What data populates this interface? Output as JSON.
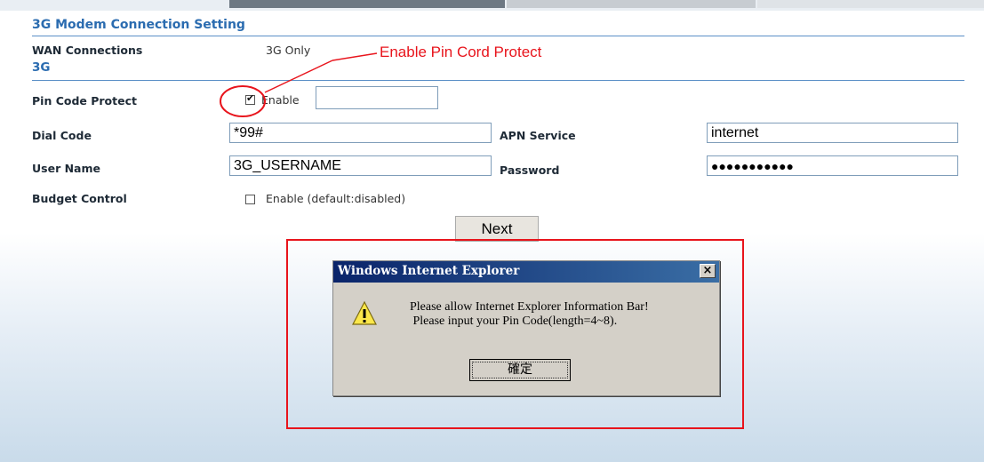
{
  "section": {
    "title": "3G Modem Connection Setting",
    "subtitle": "3G"
  },
  "wan": {
    "label": "WAN Connections",
    "value": "3G Only"
  },
  "pin": {
    "label": "Pin Code Protect",
    "enable_label": "Enable",
    "checked": true,
    "value": ""
  },
  "dial": {
    "label": "Dial Code",
    "value": "*99#"
  },
  "apn": {
    "label": "APN Service",
    "value": "internet"
  },
  "user": {
    "label": "User Name",
    "value": "3G_USERNAME"
  },
  "password": {
    "label": "Password",
    "value": "●●●●●●●●●●●"
  },
  "budget": {
    "label": "Budget Control",
    "enable_label": "Enable (default:disabled)",
    "checked": false
  },
  "next_button": "Next",
  "annotation": {
    "text": "Enable Pin Cord Protect",
    "color": "#e8141c"
  },
  "dialog": {
    "title": "Windows Internet Explorer",
    "close": "×",
    "line1": "Please allow Internet Explorer Information Bar!",
    "line2": " Please input your Pin Code(length=4~8).",
    "ok_label": "確定",
    "icon": "warning-icon"
  },
  "colors": {
    "header": "#2b6cb0",
    "rule": "#5b8fc7",
    "annotation": "#e8141c",
    "dialog_title": "#0a246a"
  }
}
